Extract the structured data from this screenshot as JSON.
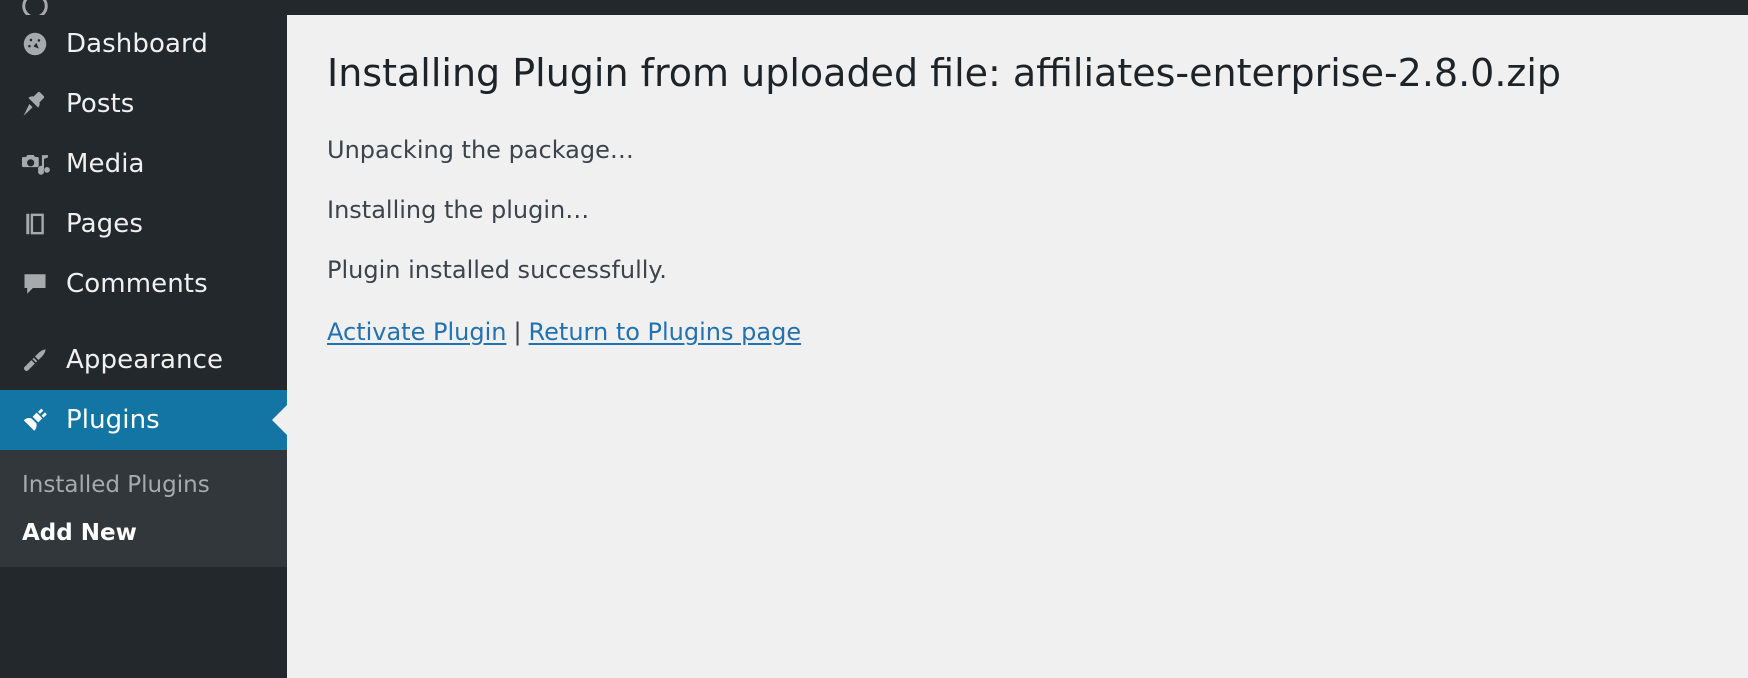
{
  "admin_bar": {
    "visible": true,
    "background": "#23282d"
  },
  "sidebar": {
    "background": "#23282d",
    "submenu_background": "#32373c",
    "current_color": "#1275a3",
    "items": [
      {
        "label": "Dashboard",
        "icon": "dashboard-icon",
        "current": false
      },
      {
        "label": "Posts",
        "icon": "pin-icon",
        "current": false
      },
      {
        "label": "Media",
        "icon": "media-icon",
        "current": false
      },
      {
        "label": "Pages",
        "icon": "pages-icon",
        "current": false
      },
      {
        "label": "Comments",
        "icon": "comments-icon",
        "current": false
      },
      {
        "label": "Appearance",
        "icon": "paintbrush-icon",
        "current": false
      },
      {
        "label": "Plugins",
        "icon": "plug-icon",
        "current": true
      }
    ],
    "submenu": {
      "parent": "Plugins",
      "items": [
        {
          "label": "Installed Plugins",
          "current": false
        },
        {
          "label": "Add New",
          "current": true
        }
      ]
    }
  },
  "main": {
    "title": "Installing Plugin from uploaded file: affiliates-enterprise-2.8.0.zip",
    "status_lines": [
      "Unpacking the package…",
      "Installing the plugin…",
      "Plugin installed successfully."
    ],
    "actions": {
      "activate_label": "Activate Plugin",
      "separator": "|",
      "return_label": "Return to Plugins page",
      "link_color": "#2271b1"
    }
  }
}
